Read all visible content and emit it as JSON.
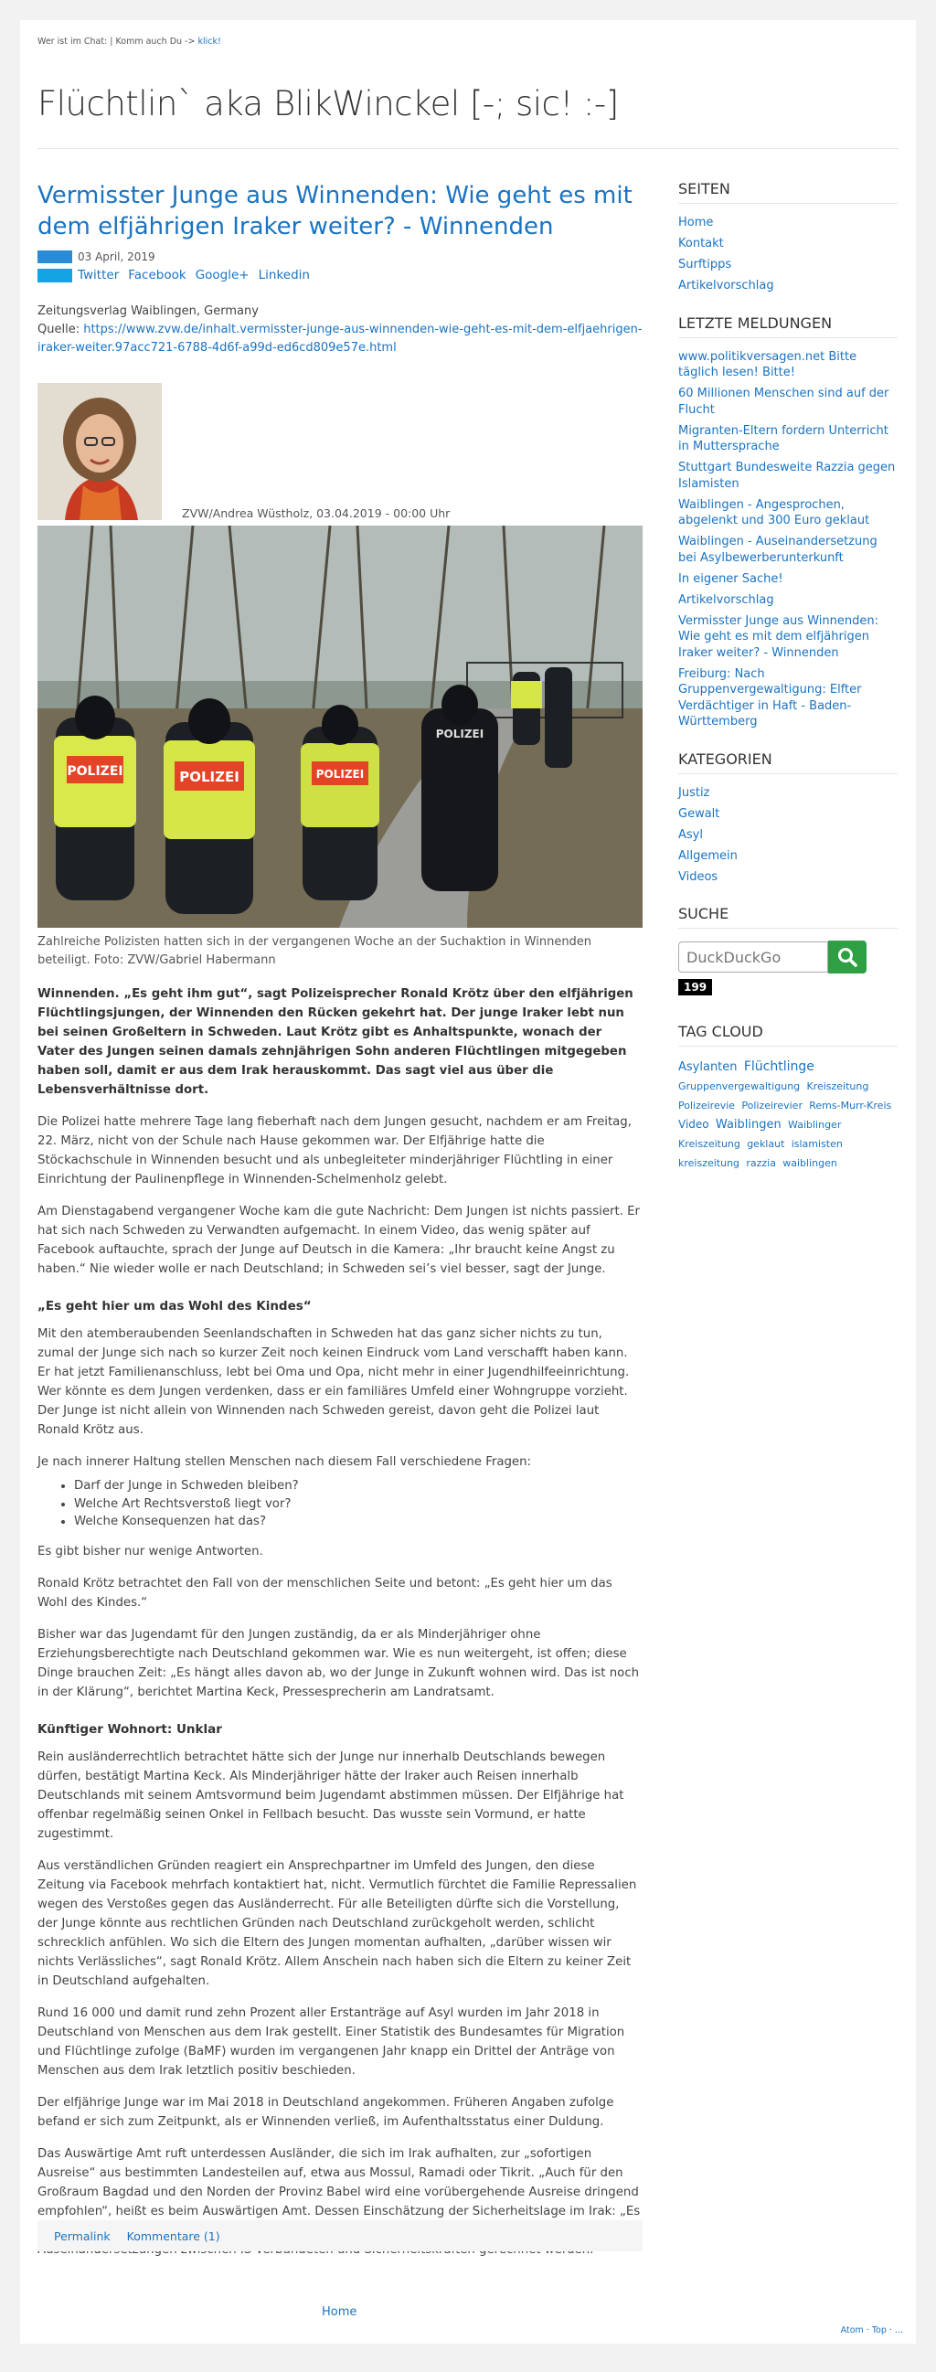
{
  "topbar": {
    "text": "Wer ist im Chat: | Komm auch Du ->",
    "link": "klick!"
  },
  "site": {
    "title": "Flüchtlin` aka BlikWinckel [-; sic! :-]"
  },
  "colors": {
    "link": "#1a73c2",
    "swatch_blue_dark": "#2a8bd6",
    "swatch_blue_light": "#13a4e4",
    "search_button": "#2ea043"
  },
  "post": {
    "title": "Vermisster Junge aus Winnenden: Wie geht es mit dem elfjährigen Iraker weiter? - Winnenden",
    "date": "03 April, 2019",
    "share": [
      "Twitter",
      "Facebook",
      "Google+",
      "Linkedin"
    ],
    "publisher": "Zeitungsverlag Waiblingen, Germany",
    "source_label": "Quelle:",
    "source_url": "https://www.zvw.de/inhalt.vermisster-junge-aus-winnenden-wie-geht-es-mit-dem-elfjaehrigen-iraker-weiter.97acc721-6788-4d6f-a99d-ed6cd809e57e.html",
    "author_credit": "ZVW/Andrea Wüstholz, 03.04.2019 - 00:00 Uhr",
    "photo_vests": [
      "POLIZEI",
      "POLIZEI",
      "POLIZEI",
      "POLIZEI"
    ],
    "caption": "Zahlreiche Polizisten hatten sich in der vergangenen Woche an der Suchaktion in Winnenden beteiligt. Foto: ZVW/Gabriel Habermann",
    "lead": "Winnenden. „Es geht ihm gut“, sagt Polizeisprecher Ronald Krötz über den elfjährigen Flüchtlingsjungen, der Winnenden den Rücken gekehrt hat. Der junge Iraker lebt nun bei seinen Großeltern in Schweden. Laut Krötz gibt es Anhaltspunkte, wonach der Vater des Jungen seinen damals zehnjährigen Sohn anderen Flüchtlingen mitgegeben haben soll, damit er aus dem Irak herauskommt. Das sagt viel aus über die Lebensverhältnisse dort.",
    "p1": "Die Polizei hatte mehrere Tage lang fieberhaft nach dem Jungen gesucht, nachdem er am Freitag, 22. März, nicht von der Schule nach Hause gekommen war. Der Elfjährige hatte die Stöckachschule in Winnenden besucht und als unbegleiteter minderjähriger Flüchtling in einer Einrichtung der Paulinenpflege in Winnenden-Schelmenholz gelebt.",
    "p2": "Am Dienstagabend vergangener Woche kam die gute Nachricht: Dem Jungen ist nichts passiert. Er hat sich nach Schweden zu Verwandten aufgemacht. In einem Video, das wenig später auf Facebook auftauchte, sprach der Junge auf Deutsch in die Kamera: „Ihr braucht keine Angst zu haben.“ Nie wieder wolle er nach Deutschland; in Schweden sei’s viel besser, sagt der Junge.",
    "h1": "„Es geht hier um das Wohl des Kindes“",
    "p3": "Mit den atemberaubenden Seenlandschaften in Schweden hat das ganz sicher nichts zu tun, zumal der Junge sich nach so kurzer Zeit noch keinen Eindruck vom Land verschafft haben kann. Er hat jetzt Familienanschluss, lebt bei Oma und Opa, nicht mehr in einer Jugendhilfeeinrichtung. Wer könnte es dem Jungen verdenken, dass er ein familiäres Umfeld einer Wohngruppe vorzieht. Der Junge ist nicht allein von Winnenden nach Schweden gereist, davon geht die Polizei laut Ronald Krötz aus.",
    "p4": "Je nach innerer Haltung stellen Menschen nach diesem Fall verschiedene Fragen:",
    "questions": [
      "Darf der Junge in Schweden bleiben?",
      "Welche Art Rechtsverstoß liegt vor?",
      "Welche Konsequenzen hat das?"
    ],
    "p5": "Es gibt bisher nur wenige Antworten.",
    "p6": "Ronald Krötz betrachtet den Fall von der menschlichen Seite und betont: „Es geht hier um das Wohl des Kindes.“",
    "p7": "Bisher war das Jugendamt für den Jungen zuständig, da er als Minderjähriger ohne Erziehungsberechtigte nach Deutschland gekommen war. Wie es nun weitergeht, ist offen; diese Dinge brauchen Zeit: „Es hängt alles davon ab, wo der Junge in Zukunft wohnen wird. Das ist noch in der Klärung“, berichtet Martina Keck, Pressesprecherin am Landratsamt.",
    "h2": "Künftiger Wohnort: Unklar",
    "p8": "Rein ausländerrechtlich betrachtet hätte sich der Junge nur innerhalb Deutschlands bewegen dürfen, bestätigt Martina Keck. Als Minderjähriger hätte der Iraker auch Reisen innerhalb Deutschlands mit seinem Amtsvormund beim Jugendamt abstimmen müssen. Der Elfjährige hat offenbar regelmäßig seinen Onkel in Fellbach besucht. Das wusste sein Vormund, er hatte zugestimmt.",
    "p9": "Aus verständlichen Gründen reagiert ein Ansprechpartner im Umfeld des Jungen, den diese Zeitung via Facebook mehrfach kontaktiert hat, nicht. Vermutlich fürchtet die Familie Repressalien wegen des Verstoßes gegen das Ausländerrecht. Für alle Beteiligten dürfte sich die Vorstellung, der Junge könnte aus rechtlichen Gründen nach Deutschland zurückgeholt werden, schlicht schrecklich anfühlen. Wo sich die Eltern des Jungen momentan aufhalten, „darüber wissen wir nichts Verlässliches“, sagt Ronald Krötz. Allem Anschein nach haben sich die Eltern zu keiner Zeit in Deutschland aufgehalten.",
    "p10": "Rund 16 000 und damit rund zehn Prozent aller Erstanträge auf Asyl wurden im Jahr 2018 in Deutschland von Menschen aus dem Irak gestellt. Einer Statistik des Bundesamtes für Migration und Flüchtlinge zufolge (BaMF) wurden im vergangenen Jahr knapp ein Drittel der Anträge von Menschen aus dem Irak letztlich positiv beschieden.",
    "p11": "Der elfjährige Junge war im Mai 2018 in Deutschland angekommen. Früheren Angaben zufolge befand er sich zum Zeitpunkt, als er Winnenden verließ, im Aufenthaltsstatus einer Duldung.",
    "p12": "Das Auswärtige Amt ruft unterdessen Ausländer, die sich im Irak aufhalten, zur „sofortigen Ausreise“ aus bestimmten Landesteilen auf, etwa aus Mossul, Ramadi oder Tikrit. „Auch für den Großraum Bagdad und den Norden der Provinz Babel wird eine vorübergehende Ausreise dringend empfohlen“, heißt es beim Auswärtigen Amt. Dessen Einschätzung der Sicherheitslage im Irak: „Es muss landesweit weiterhin mit schweren Anschlägen und offenen bewaffneten Auseinandersetzungen zwischen IS-Verbündeten und Sicherheitskräften gerechnet werden.“",
    "permalink": "Permalink",
    "comments": "Kommentare (1)"
  },
  "sidebar": {
    "pages_heading": "SEITEN",
    "pages": [
      "Home",
      "Kontakt",
      "Surftipps",
      "Artikelvorschlag"
    ],
    "news_heading": "LETZTE MELDUNGEN",
    "news": [
      "www.politikversagen.net Bitte täglich lesen! Bitte!",
      "60 Millionen Menschen sind auf der Flucht",
      "Migranten-Eltern fordern Unterricht in Muttersprache",
      "Stuttgart Bundesweite Razzia gegen Islamisten",
      "Waiblingen - Angesprochen, abgelenkt und 300 Euro geklaut",
      "Waiblingen - Auseinandersetzung bei Asylbewerberunterkunft",
      "In eigener Sache!",
      "Artikelvorschlag",
      "Vermisster Junge aus Winnenden: Wie geht es mit dem elfjährigen Iraker weiter? - Winnenden",
      "Freiburg: Nach Gruppenvergewaltigung: Elfter Verdächtiger in Haft - Baden-Württemberg"
    ],
    "categories_heading": "KATEGORIEN",
    "categories": [
      "Justiz",
      "Gewalt",
      "Asyl",
      "Allgemein",
      "Videos"
    ],
    "search_heading": "SUCHE",
    "search_placeholder": "DuckDuckGo",
    "counter": "199",
    "tags_heading": "TAG CLOUD",
    "tags": [
      {
        "label": "Asylanten",
        "size": 13
      },
      {
        "label": "Flüchtlinge",
        "size": 14
      },
      {
        "label": "Gruppenvergewaltigung",
        "size": 11
      },
      {
        "label": "Kreiszeitung",
        "size": 11
      },
      {
        "label": "Polizeirevie",
        "size": 11
      },
      {
        "label": "Polizeirevier",
        "size": 11
      },
      {
        "label": "Rems-Murr-Kreis",
        "size": 11
      },
      {
        "label": "Video",
        "size": 12
      },
      {
        "label": "Waiblingen",
        "size": 13
      },
      {
        "label": "Waiblinger Kreiszeitung",
        "size": 11
      },
      {
        "label": "geklaut",
        "size": 11
      },
      {
        "label": "islamisten",
        "size": 11
      },
      {
        "label": "kreiszeitung",
        "size": 11
      },
      {
        "label": "razzia",
        "size": 11
      },
      {
        "label": "waiblingen",
        "size": 11
      }
    ]
  },
  "footer": {
    "home": "Home",
    "right": "Atom · Top · ..."
  }
}
